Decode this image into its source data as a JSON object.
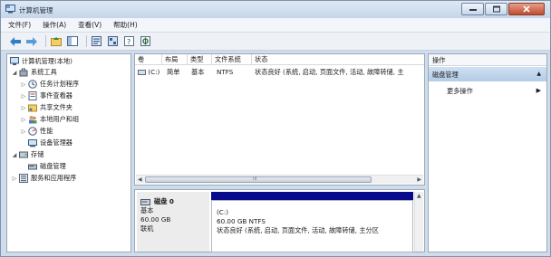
{
  "window": {
    "title": "计算机管理"
  },
  "menu": [
    {
      "label": "文件(F)"
    },
    {
      "label": "操作(A)"
    },
    {
      "label": "查看(V)"
    },
    {
      "label": "帮助(H)"
    }
  ],
  "toolbar": {
    "icons": [
      "back-arrow-icon",
      "forward-arrow-icon",
      "up-folder-icon",
      "show-hide-tree-icon",
      "properties-icon",
      "export-list-icon",
      "help-icon",
      "settings-icon"
    ]
  },
  "tree": {
    "root": "计算机管理(本地)",
    "system_tools": "系统工具",
    "task_scheduler": "任务计划程序",
    "event_viewer": "事件查看器",
    "shared_folders": "共享文件夹",
    "local_users": "本地用户和组",
    "performance": "性能",
    "device_manager": "设备管理器",
    "storage": "存储",
    "disk_management": "磁盘管理",
    "services_apps": "服务和应用程序"
  },
  "volume_list": {
    "columns": [
      "卷",
      "布局",
      "类型",
      "文件系统",
      "状态"
    ],
    "rows": [
      {
        "volume": "(C:)",
        "layout": "简单",
        "type": "基本",
        "fs": "NTFS",
        "status": "状态良好 (系统, 启动, 页面文件, 活动, 故障转储, 主"
      }
    ],
    "scroll_mark": "III"
  },
  "disk_map": {
    "disk_name": "磁盘 0",
    "disk_type": "基本",
    "disk_size": "60.00 GB",
    "disk_status": "联机",
    "volume_label": "(C:)",
    "volume_size_fs": "60.00 GB NTFS",
    "volume_status": "状态良好 (系统, 启动, 页面文件, 活动, 故障转储, 主分区"
  },
  "actions": {
    "header": "操作",
    "section": "磁盘管理",
    "more": "更多操作"
  },
  "colors": {
    "selected_blue": "#0a0a8c",
    "action_highlight": "#b3cbe6",
    "window_frame": "#cfdceb"
  }
}
